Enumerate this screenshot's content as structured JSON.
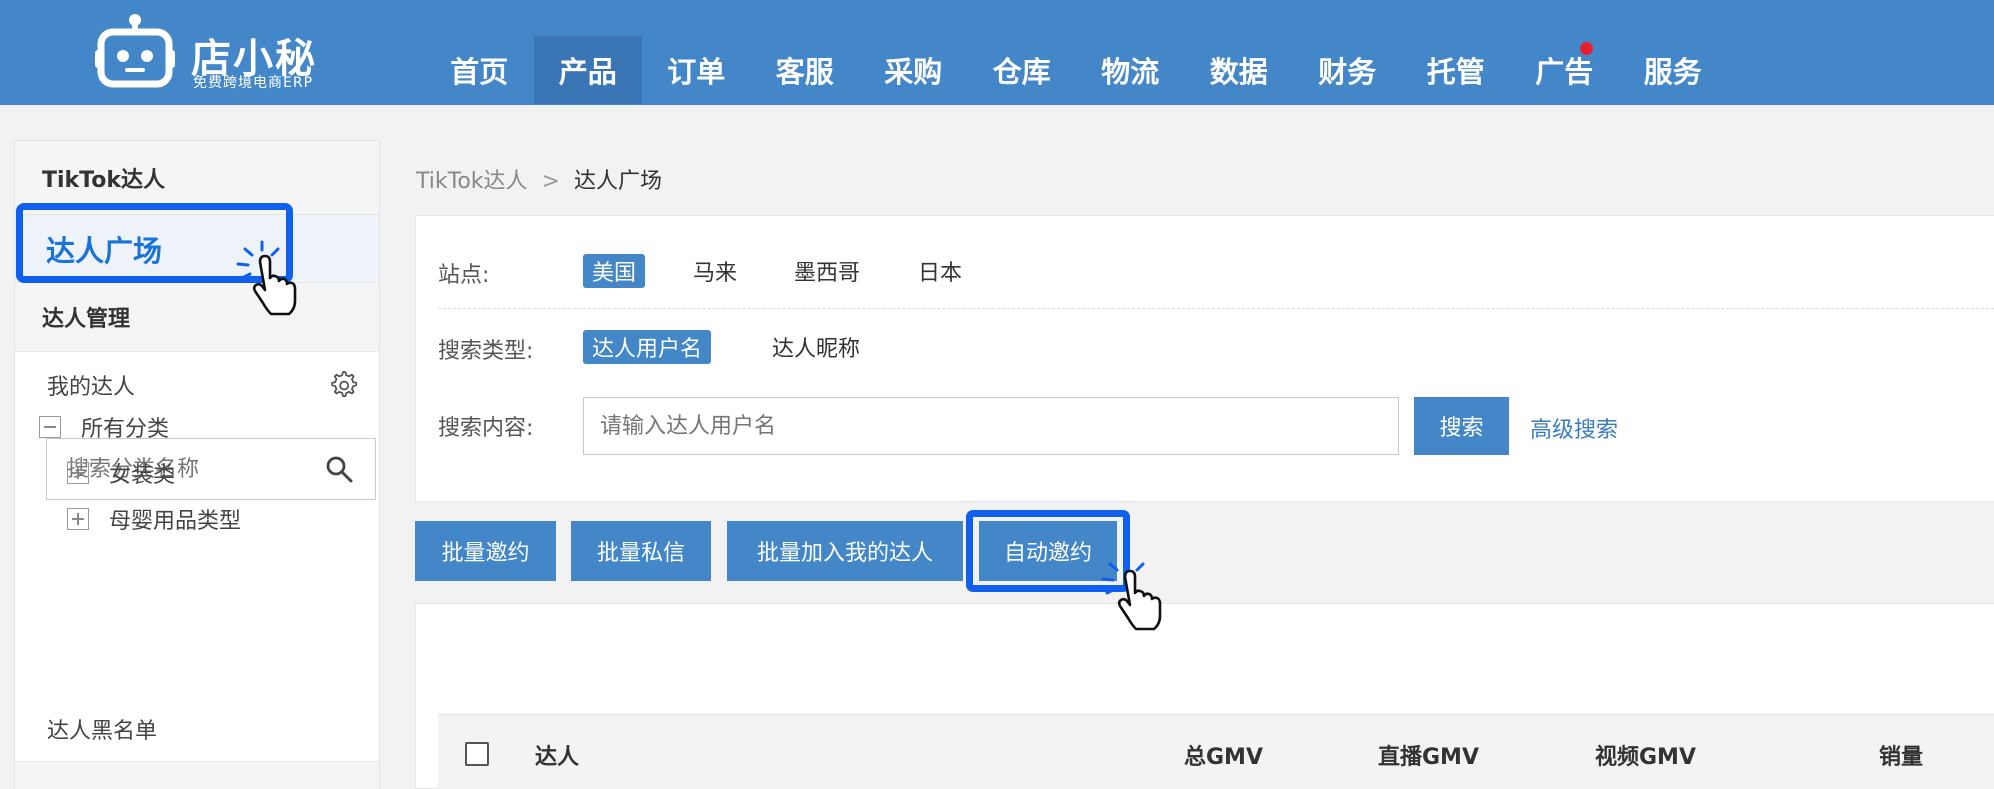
{
  "brand": {
    "name": "店小秘",
    "tagline": "免费跨境电商ERP"
  },
  "nav": {
    "items": [
      {
        "label": "首页"
      },
      {
        "label": "产品",
        "active": true
      },
      {
        "label": "订单"
      },
      {
        "label": "客服"
      },
      {
        "label": "采购"
      },
      {
        "label": "仓库"
      },
      {
        "label": "物流"
      },
      {
        "label": "数据"
      },
      {
        "label": "财务"
      },
      {
        "label": "托管"
      },
      {
        "label": "广告",
        "badge_dot": true
      },
      {
        "label": "服务"
      }
    ]
  },
  "sidebar": {
    "group_title": "TikTok达人",
    "active_item": "达人广场",
    "manage_title": "达人管理",
    "my_talent": "我的达人",
    "search_placeholder": "搜索分类名称",
    "tree": {
      "root": "所有分类",
      "children": [
        "女装类",
        "母婴用品类型"
      ]
    },
    "blacklist": "达人黑名单"
  },
  "breadcrumb": {
    "parent": "TikTok达人",
    "separator": ">",
    "current": "达人广场"
  },
  "filters": {
    "site_label": "站点:",
    "sites": [
      {
        "label": "美国",
        "selected": true
      },
      {
        "label": "马来"
      },
      {
        "label": "墨西哥"
      },
      {
        "label": "日本"
      }
    ],
    "type_label": "搜索类型:",
    "types": [
      {
        "label": "达人用户名",
        "selected": true
      },
      {
        "label": "达人昵称"
      }
    ],
    "content_label": "搜索内容:",
    "search_placeholder": "请输入达人用户名",
    "search_button": "搜索",
    "advanced_link": "高级搜索"
  },
  "actions": {
    "batch_invite": "批量邀约",
    "batch_message": "批量私信",
    "batch_add": "批量加入我的达人",
    "auto_invite": "自动邀约"
  },
  "table": {
    "columns": [
      "达人",
      "总GMV",
      "直播GMV",
      "视频GMV",
      "销量"
    ]
  },
  "colors": {
    "header_bg": "#4387c9",
    "primary": "#4387c9",
    "highlight_border": "#1060f0",
    "badge_dot": "#e8202a",
    "link": "#3a7cc4"
  },
  "icons": {
    "logo": "robot-logo",
    "settings": "gear-icon",
    "search": "search-icon",
    "cursor": "pointing-hand-icon"
  }
}
